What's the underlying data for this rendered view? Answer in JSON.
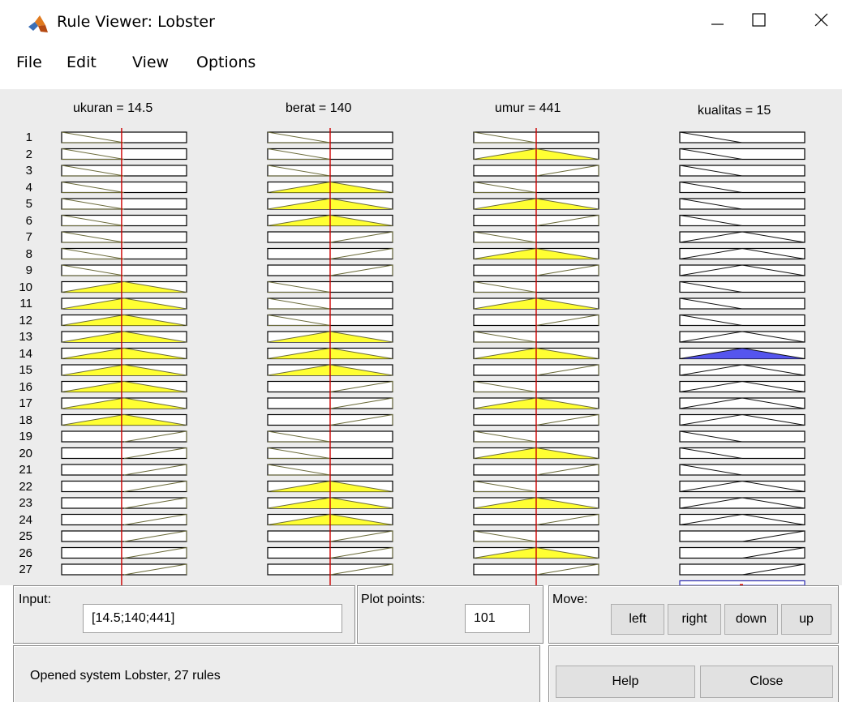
{
  "window": {
    "title": "Rule Viewer: Lobster"
  },
  "menu": [
    "File",
    "Edit",
    "View",
    "Options"
  ],
  "variables": [
    {
      "title": "ukuran = 14.5"
    },
    {
      "title": "berat = 140"
    },
    {
      "title": "umur = 441"
    },
    {
      "title": "kualitas = 15"
    }
  ],
  "rules": {
    "count": 27,
    "input_value_fraction": [
      0.48,
      0.5,
      0.5
    ],
    "rows": [
      {
        "n": "1",
        "mf": [
          "L",
          "L",
          "L",
          "L"
        ],
        "act": [
          0,
          0,
          0
        ],
        "out": 0
      },
      {
        "n": "2",
        "mf": [
          "L",
          "L",
          "M",
          "L"
        ],
        "act": [
          0,
          0,
          1
        ],
        "out": 0
      },
      {
        "n": "3",
        "mf": [
          "L",
          "L",
          "H",
          "L"
        ],
        "act": [
          0,
          0,
          0
        ],
        "out": 0
      },
      {
        "n": "4",
        "mf": [
          "L",
          "M",
          "L",
          "L"
        ],
        "act": [
          0,
          1,
          0
        ],
        "out": 0
      },
      {
        "n": "5",
        "mf": [
          "L",
          "M",
          "M",
          "L"
        ],
        "act": [
          0,
          1,
          1
        ],
        "out": 0
      },
      {
        "n": "6",
        "mf": [
          "L",
          "M",
          "H",
          "L"
        ],
        "act": [
          0,
          1,
          0
        ],
        "out": 0
      },
      {
        "n": "7",
        "mf": [
          "L",
          "H",
          "L",
          "M"
        ],
        "act": [
          0,
          0,
          0
        ],
        "out": 0
      },
      {
        "n": "8",
        "mf": [
          "L",
          "H",
          "M",
          "M"
        ],
        "act": [
          0,
          0,
          1
        ],
        "out": 0
      },
      {
        "n": "9",
        "mf": [
          "L",
          "H",
          "H",
          "M"
        ],
        "act": [
          0,
          0,
          0
        ],
        "out": 0
      },
      {
        "n": "10",
        "mf": [
          "M",
          "L",
          "L",
          "L"
        ],
        "act": [
          1,
          0,
          0
        ],
        "out": 0
      },
      {
        "n": "11",
        "mf": [
          "M",
          "L",
          "M",
          "L"
        ],
        "act": [
          1,
          0,
          1
        ],
        "out": 0
      },
      {
        "n": "12",
        "mf": [
          "M",
          "L",
          "H",
          "L"
        ],
        "act": [
          1,
          0,
          0
        ],
        "out": 0
      },
      {
        "n": "13",
        "mf": [
          "M",
          "M",
          "L",
          "M"
        ],
        "act": [
          1,
          1,
          0
        ],
        "out": 0
      },
      {
        "n": "14",
        "mf": [
          "M",
          "M",
          "M",
          "M"
        ],
        "act": [
          1,
          1,
          1
        ],
        "out": 1
      },
      {
        "n": "15",
        "mf": [
          "M",
          "M",
          "H",
          "M"
        ],
        "act": [
          1,
          1,
          0
        ],
        "out": 0
      },
      {
        "n": "16",
        "mf": [
          "M",
          "H",
          "L",
          "M"
        ],
        "act": [
          1,
          0,
          0
        ],
        "out": 0
      },
      {
        "n": "17",
        "mf": [
          "M",
          "H",
          "M",
          "M"
        ],
        "act": [
          1,
          0,
          1
        ],
        "out": 0
      },
      {
        "n": "18",
        "mf": [
          "M",
          "H",
          "H",
          "M"
        ],
        "act": [
          1,
          0,
          0
        ],
        "out": 0
      },
      {
        "n": "19",
        "mf": [
          "H",
          "L",
          "L",
          "L"
        ],
        "act": [
          0,
          0,
          0
        ],
        "out": 0
      },
      {
        "n": "20",
        "mf": [
          "H",
          "L",
          "M",
          "L"
        ],
        "act": [
          0,
          0,
          1
        ],
        "out": 0
      },
      {
        "n": "21",
        "mf": [
          "H",
          "L",
          "H",
          "L"
        ],
        "act": [
          0,
          0,
          0
        ],
        "out": 0
      },
      {
        "n": "22",
        "mf": [
          "H",
          "M",
          "L",
          "M"
        ],
        "act": [
          0,
          1,
          0
        ],
        "out": 0
      },
      {
        "n": "23",
        "mf": [
          "H",
          "M",
          "M",
          "M"
        ],
        "act": [
          0,
          1,
          1
        ],
        "out": 0
      },
      {
        "n": "24",
        "mf": [
          "H",
          "M",
          "H",
          "M"
        ],
        "act": [
          0,
          1,
          0
        ],
        "out": 0
      },
      {
        "n": "25",
        "mf": [
          "H",
          "H",
          "L",
          "H"
        ],
        "act": [
          0,
          0,
          0
        ],
        "out": 0
      },
      {
        "n": "26",
        "mf": [
          "H",
          "H",
          "M",
          "H"
        ],
        "act": [
          0,
          0,
          1
        ],
        "out": 0
      },
      {
        "n": "27",
        "mf": [
          "H",
          "H",
          "H",
          "H"
        ],
        "act": [
          0,
          0,
          0
        ],
        "out": 0
      }
    ]
  },
  "controls": {
    "input_label": "Input:",
    "input_value": "[14.5;140;441]",
    "plot_points_label": "Plot points:",
    "plot_points_value": "101",
    "move_label": "Move:",
    "move_left": "left",
    "move_right": "right",
    "move_down": "down",
    "move_up": "up",
    "status": "Opened system Lobster, 27 rules",
    "help": "Help",
    "close": "Close"
  },
  "colors": {
    "input_fill": "#ffff33",
    "output_fill": "#5555ee",
    "index_line": "#cc0000",
    "background": "#ececec"
  }
}
